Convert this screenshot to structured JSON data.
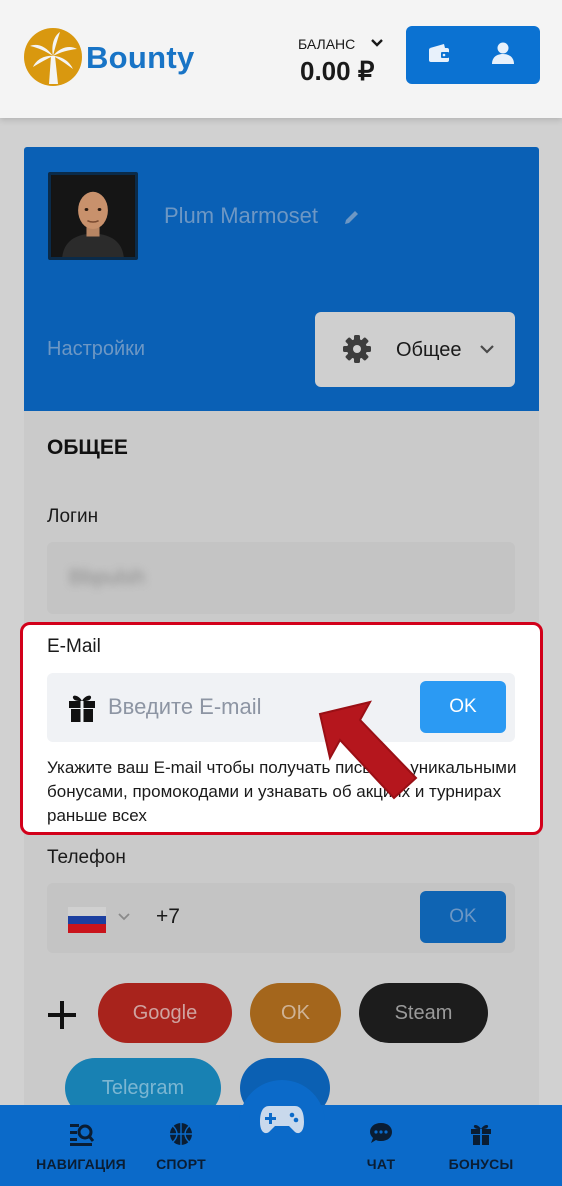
{
  "header": {
    "brand": "Bounty",
    "balance_label": "БАЛАНС",
    "balance_value": "0.00 ₽",
    "icons": [
      "logo-icon",
      "chevron-down-icon",
      "wallet-icon",
      "user-icon"
    ]
  },
  "profile": {
    "username": "Plum Marmoset",
    "settings_label": "Настройки",
    "settings_selected": "Общее"
  },
  "general": {
    "title": "ОБЩЕЕ",
    "login_label": "Логин",
    "login_value": "Bbpulsh",
    "email_label": "E-Mail",
    "email_placeholder": "Введите E-mail",
    "email_ok": "OK",
    "email_hint": "Укажите ваш E-mail чтобы получать письма с уникальными бонусами, промокодами и узнавать об акциях и турнирах раньше всех",
    "phone_label": "Телефон",
    "phone_code": "+7",
    "phone_ok": "OK"
  },
  "social": {
    "buttons": [
      "Google",
      "OK",
      "Steam",
      "Telegram"
    ]
  },
  "bottom_nav": {
    "items": [
      "НАВИГАЦИЯ",
      "СПОРТ",
      "ЧАТ",
      "БОНУСЫ"
    ]
  },
  "colors": {
    "accent": "#0b6ac9",
    "highlight_border": "#d2001a",
    "ok_button": "#2b9af3"
  }
}
